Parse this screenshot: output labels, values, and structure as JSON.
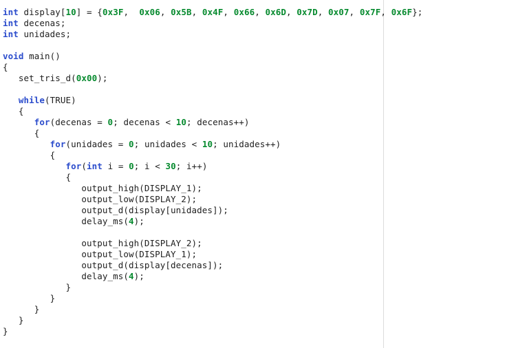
{
  "editor": {
    "title": "C source code listing",
    "language": "C",
    "background_color": "#ffffff",
    "text_color": "#202020",
    "keyword_color": "#2b4ccc",
    "number_color": "#068a2e",
    "margin_guide_color": "#dcdcdc",
    "margin_guide_column_x": 557
  },
  "code": {
    "lines": [
      {
        "index": 1,
        "text": "int display[10] = {0x3F,  0x06, 0x5B, 0x4F, 0x66, 0x6D, 0x7D, 0x07, 0x7F, 0x6F};",
        "tokens": [
          {
            "t": "int",
            "k": "kw"
          },
          {
            "t": " display[",
            "k": "plain"
          },
          {
            "t": "10",
            "k": "num"
          },
          {
            "t": "] = {",
            "k": "plain"
          },
          {
            "t": "0x3F",
            "k": "num"
          },
          {
            "t": ",  ",
            "k": "plain"
          },
          {
            "t": "0x06",
            "k": "num"
          },
          {
            "t": ", ",
            "k": "plain"
          },
          {
            "t": "0x5B",
            "k": "num"
          },
          {
            "t": ", ",
            "k": "plain"
          },
          {
            "t": "0x4F",
            "k": "num"
          },
          {
            "t": ", ",
            "k": "plain"
          },
          {
            "t": "0x66",
            "k": "num"
          },
          {
            "t": ", ",
            "k": "plain"
          },
          {
            "t": "0x6D",
            "k": "num"
          },
          {
            "t": ", ",
            "k": "plain"
          },
          {
            "t": "0x7D",
            "k": "num"
          },
          {
            "t": ", ",
            "k": "plain"
          },
          {
            "t": "0x07",
            "k": "num"
          },
          {
            "t": ", ",
            "k": "plain"
          },
          {
            "t": "0x7F",
            "k": "num"
          },
          {
            "t": ", ",
            "k": "plain"
          },
          {
            "t": "0x6F",
            "k": "num"
          },
          {
            "t": "};",
            "k": "plain"
          }
        ]
      },
      {
        "index": 2,
        "text": "int decenas;",
        "tokens": [
          {
            "t": "int",
            "k": "kw"
          },
          {
            "t": " decenas;",
            "k": "plain"
          }
        ]
      },
      {
        "index": 3,
        "text": "int unidades;",
        "tokens": [
          {
            "t": "int",
            "k": "kw"
          },
          {
            "t": " unidades;",
            "k": "plain"
          }
        ]
      },
      {
        "index": 4,
        "text": "",
        "tokens": []
      },
      {
        "index": 5,
        "text": "void main()",
        "tokens": [
          {
            "t": "void",
            "k": "kw"
          },
          {
            "t": " main()",
            "k": "plain"
          }
        ]
      },
      {
        "index": 6,
        "text": "{",
        "tokens": [
          {
            "t": "{",
            "k": "plain"
          }
        ]
      },
      {
        "index": 7,
        "text": "   set_tris_d(0x00);",
        "tokens": [
          {
            "t": "   set_tris_d(",
            "k": "plain"
          },
          {
            "t": "0x00",
            "k": "num"
          },
          {
            "t": ");",
            "k": "plain"
          }
        ]
      },
      {
        "index": 8,
        "text": "",
        "tokens": []
      },
      {
        "index": 9,
        "text": "   while(TRUE)",
        "tokens": [
          {
            "t": "   ",
            "k": "plain"
          },
          {
            "t": "while",
            "k": "kw"
          },
          {
            "t": "(TRUE)",
            "k": "plain"
          }
        ]
      },
      {
        "index": 10,
        "text": "   {",
        "tokens": [
          {
            "t": "   {",
            "k": "plain"
          }
        ]
      },
      {
        "index": 11,
        "text": "      for(decenas = 0; decenas < 10; decenas++)",
        "tokens": [
          {
            "t": "      ",
            "k": "plain"
          },
          {
            "t": "for",
            "k": "kw"
          },
          {
            "t": "(decenas = ",
            "k": "plain"
          },
          {
            "t": "0",
            "k": "num"
          },
          {
            "t": "; decenas < ",
            "k": "plain"
          },
          {
            "t": "10",
            "k": "num"
          },
          {
            "t": "; decenas++)",
            "k": "plain"
          }
        ]
      },
      {
        "index": 12,
        "text": "      {",
        "tokens": [
          {
            "t": "      {",
            "k": "plain"
          }
        ]
      },
      {
        "index": 13,
        "text": "         for(unidades = 0; unidades < 10; unidades++)",
        "tokens": [
          {
            "t": "         ",
            "k": "plain"
          },
          {
            "t": "for",
            "k": "kw"
          },
          {
            "t": "(unidades = ",
            "k": "plain"
          },
          {
            "t": "0",
            "k": "num"
          },
          {
            "t": "; unidades < ",
            "k": "plain"
          },
          {
            "t": "10",
            "k": "num"
          },
          {
            "t": "; unidades++)",
            "k": "plain"
          }
        ]
      },
      {
        "index": 14,
        "text": "         {",
        "tokens": [
          {
            "t": "         {",
            "k": "plain"
          }
        ]
      },
      {
        "index": 15,
        "text": "            for(int i = 0; i < 30; i++)",
        "tokens": [
          {
            "t": "            ",
            "k": "plain"
          },
          {
            "t": "for",
            "k": "kw"
          },
          {
            "t": "(",
            "k": "plain"
          },
          {
            "t": "int",
            "k": "kw"
          },
          {
            "t": " i = ",
            "k": "plain"
          },
          {
            "t": "0",
            "k": "num"
          },
          {
            "t": "; i < ",
            "k": "plain"
          },
          {
            "t": "30",
            "k": "num"
          },
          {
            "t": "; i++)",
            "k": "plain"
          }
        ]
      },
      {
        "index": 16,
        "text": "            {",
        "tokens": [
          {
            "t": "            {",
            "k": "plain"
          }
        ]
      },
      {
        "index": 17,
        "text": "               output_high(DISPLAY_1);",
        "tokens": [
          {
            "t": "               output_high(DISPLAY_1);",
            "k": "plain"
          }
        ]
      },
      {
        "index": 18,
        "text": "               output_low(DISPLAY_2);",
        "tokens": [
          {
            "t": "               output_low(DISPLAY_2);",
            "k": "plain"
          }
        ]
      },
      {
        "index": 19,
        "text": "               output_d(display[unidades]);",
        "tokens": [
          {
            "t": "               output_d(display[unidades]);",
            "k": "plain"
          }
        ]
      },
      {
        "index": 20,
        "text": "               delay_ms(4);",
        "tokens": [
          {
            "t": "               delay_ms(",
            "k": "plain"
          },
          {
            "t": "4",
            "k": "num"
          },
          {
            "t": ");",
            "k": "plain"
          }
        ]
      },
      {
        "index": 21,
        "text": "",
        "tokens": []
      },
      {
        "index": 22,
        "text": "               output_high(DISPLAY_2);",
        "tokens": [
          {
            "t": "               output_high(DISPLAY_2);",
            "k": "plain"
          }
        ]
      },
      {
        "index": 23,
        "text": "               output_low(DISPLAY_1);",
        "tokens": [
          {
            "t": "               output_low(DISPLAY_1);",
            "k": "plain"
          }
        ]
      },
      {
        "index": 24,
        "text": "               output_d(display[decenas]);",
        "tokens": [
          {
            "t": "               output_d(display[decenas]);",
            "k": "plain"
          }
        ]
      },
      {
        "index": 25,
        "text": "               delay_ms(4);",
        "tokens": [
          {
            "t": "               delay_ms(",
            "k": "plain"
          },
          {
            "t": "4",
            "k": "num"
          },
          {
            "t": ");",
            "k": "plain"
          }
        ]
      },
      {
        "index": 26,
        "text": "            }",
        "tokens": [
          {
            "t": "            }",
            "k": "plain"
          }
        ]
      },
      {
        "index": 27,
        "text": "         }",
        "tokens": [
          {
            "t": "         }",
            "k": "plain"
          }
        ]
      },
      {
        "index": 28,
        "text": "      }",
        "tokens": [
          {
            "t": "      }",
            "k": "plain"
          }
        ]
      },
      {
        "index": 29,
        "text": "   }",
        "tokens": [
          {
            "t": "   }",
            "k": "plain"
          }
        ]
      },
      {
        "index": 30,
        "text": "}",
        "tokens": [
          {
            "t": "}",
            "k": "plain"
          }
        ]
      }
    ]
  }
}
